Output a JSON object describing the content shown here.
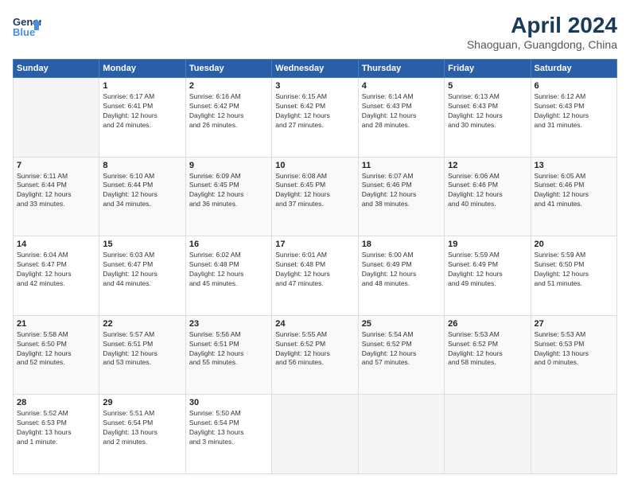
{
  "header": {
    "logo_line1": "General",
    "logo_line2": "Blue",
    "month": "April 2024",
    "location": "Shaoguan, Guangdong, China"
  },
  "weekdays": [
    "Sunday",
    "Monday",
    "Tuesday",
    "Wednesday",
    "Thursday",
    "Friday",
    "Saturday"
  ],
  "weeks": [
    [
      {
        "day": "",
        "info": ""
      },
      {
        "day": "1",
        "info": "Sunrise: 6:17 AM\nSunset: 6:41 PM\nDaylight: 12 hours\nand 24 minutes."
      },
      {
        "day": "2",
        "info": "Sunrise: 6:16 AM\nSunset: 6:42 PM\nDaylight: 12 hours\nand 26 minutes."
      },
      {
        "day": "3",
        "info": "Sunrise: 6:15 AM\nSunset: 6:42 PM\nDaylight: 12 hours\nand 27 minutes."
      },
      {
        "day": "4",
        "info": "Sunrise: 6:14 AM\nSunset: 6:43 PM\nDaylight: 12 hours\nand 28 minutes."
      },
      {
        "day": "5",
        "info": "Sunrise: 6:13 AM\nSunset: 6:43 PM\nDaylight: 12 hours\nand 30 minutes."
      },
      {
        "day": "6",
        "info": "Sunrise: 6:12 AM\nSunset: 6:43 PM\nDaylight: 12 hours\nand 31 minutes."
      }
    ],
    [
      {
        "day": "7",
        "info": "Sunrise: 6:11 AM\nSunset: 6:44 PM\nDaylight: 12 hours\nand 33 minutes."
      },
      {
        "day": "8",
        "info": "Sunrise: 6:10 AM\nSunset: 6:44 PM\nDaylight: 12 hours\nand 34 minutes."
      },
      {
        "day": "9",
        "info": "Sunrise: 6:09 AM\nSunset: 6:45 PM\nDaylight: 12 hours\nand 36 minutes."
      },
      {
        "day": "10",
        "info": "Sunrise: 6:08 AM\nSunset: 6:45 PM\nDaylight: 12 hours\nand 37 minutes."
      },
      {
        "day": "11",
        "info": "Sunrise: 6:07 AM\nSunset: 6:46 PM\nDaylight: 12 hours\nand 38 minutes."
      },
      {
        "day": "12",
        "info": "Sunrise: 6:06 AM\nSunset: 6:46 PM\nDaylight: 12 hours\nand 40 minutes."
      },
      {
        "day": "13",
        "info": "Sunrise: 6:05 AM\nSunset: 6:46 PM\nDaylight: 12 hours\nand 41 minutes."
      }
    ],
    [
      {
        "day": "14",
        "info": "Sunrise: 6:04 AM\nSunset: 6:47 PM\nDaylight: 12 hours\nand 42 minutes."
      },
      {
        "day": "15",
        "info": "Sunrise: 6:03 AM\nSunset: 6:47 PM\nDaylight: 12 hours\nand 44 minutes."
      },
      {
        "day": "16",
        "info": "Sunrise: 6:02 AM\nSunset: 6:48 PM\nDaylight: 12 hours\nand 45 minutes."
      },
      {
        "day": "17",
        "info": "Sunrise: 6:01 AM\nSunset: 6:48 PM\nDaylight: 12 hours\nand 47 minutes."
      },
      {
        "day": "18",
        "info": "Sunrise: 6:00 AM\nSunset: 6:49 PM\nDaylight: 12 hours\nand 48 minutes."
      },
      {
        "day": "19",
        "info": "Sunrise: 5:59 AM\nSunset: 6:49 PM\nDaylight: 12 hours\nand 49 minutes."
      },
      {
        "day": "20",
        "info": "Sunrise: 5:59 AM\nSunset: 6:50 PM\nDaylight: 12 hours\nand 51 minutes."
      }
    ],
    [
      {
        "day": "21",
        "info": "Sunrise: 5:58 AM\nSunset: 6:50 PM\nDaylight: 12 hours\nand 52 minutes."
      },
      {
        "day": "22",
        "info": "Sunrise: 5:57 AM\nSunset: 6:51 PM\nDaylight: 12 hours\nand 53 minutes."
      },
      {
        "day": "23",
        "info": "Sunrise: 5:56 AM\nSunset: 6:51 PM\nDaylight: 12 hours\nand 55 minutes."
      },
      {
        "day": "24",
        "info": "Sunrise: 5:55 AM\nSunset: 6:52 PM\nDaylight: 12 hours\nand 56 minutes."
      },
      {
        "day": "25",
        "info": "Sunrise: 5:54 AM\nSunset: 6:52 PM\nDaylight: 12 hours\nand 57 minutes."
      },
      {
        "day": "26",
        "info": "Sunrise: 5:53 AM\nSunset: 6:52 PM\nDaylight: 12 hours\nand 58 minutes."
      },
      {
        "day": "27",
        "info": "Sunrise: 5:53 AM\nSunset: 6:53 PM\nDaylight: 13 hours\nand 0 minutes."
      }
    ],
    [
      {
        "day": "28",
        "info": "Sunrise: 5:52 AM\nSunset: 6:53 PM\nDaylight: 13 hours\nand 1 minute."
      },
      {
        "day": "29",
        "info": "Sunrise: 5:51 AM\nSunset: 6:54 PM\nDaylight: 13 hours\nand 2 minutes."
      },
      {
        "day": "30",
        "info": "Sunrise: 5:50 AM\nSunset: 6:54 PM\nDaylight: 13 hours\nand 3 minutes."
      },
      {
        "day": "",
        "info": ""
      },
      {
        "day": "",
        "info": ""
      },
      {
        "day": "",
        "info": ""
      },
      {
        "day": "",
        "info": ""
      }
    ]
  ]
}
